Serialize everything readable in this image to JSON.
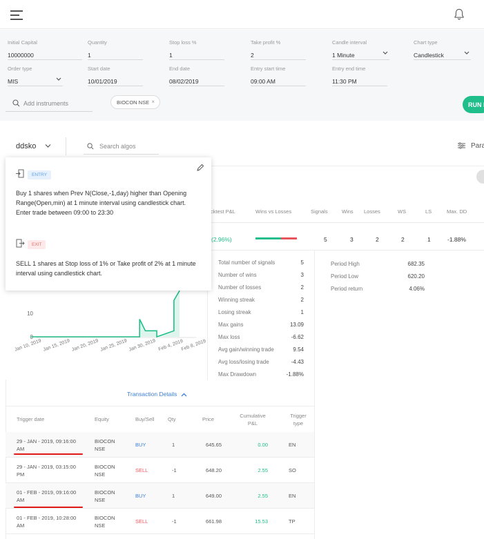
{
  "header": {
    "menu_icon": "hamburger-icon",
    "bell_icon": "bell-icon"
  },
  "form": {
    "initial_capital": {
      "label": "Initial Capital",
      "value": "10000000"
    },
    "quantity": {
      "label": "Quantity",
      "value": "1"
    },
    "stop_loss": {
      "label": "Stop loss %",
      "value": "1"
    },
    "take_profit": {
      "label": "Take profit %",
      "value": "2"
    },
    "candle_interval": {
      "label": "Candle interval",
      "value": "1 Minute"
    },
    "chart_type": {
      "label": "Chart type",
      "value": "Candlestick"
    },
    "order_type": {
      "label": "Order type",
      "value": "MIS"
    },
    "start_date": {
      "label": "Start date",
      "value": "10/01/2019"
    },
    "end_date": {
      "label": "End date",
      "value": "08/02/2019"
    },
    "entry_start_time": {
      "label": "Entry start time",
      "value": "09:00 AM"
    },
    "entry_end_time": {
      "label": "Entry end time",
      "value": "11:30 PM"
    },
    "instruments_placeholder": "Add instruments",
    "instrument_chip": "BIOCON NSE",
    "chip_close": "×",
    "run_label": "RUN I"
  },
  "algo": {
    "name": "ddsko",
    "search_placeholder": "Search algos",
    "params_label": "Para"
  },
  "popup": {
    "entry_tag": "ENTRY",
    "entry_text_1": "Buy 1 shares when Prev N(Close,-1,day) higher than Opening Range(Open,min) at 1 minute interval using candlestick chart.",
    "entry_text_2": "Enter trade between 09:00 to 23:30",
    "exit_tag": "EXIT",
    "exit_text": "SELL 1 shares at Stop loss of 1% or Take profit of 2% at 1 minute interval using candlestick chart."
  },
  "stats_header": {
    "backtest_pnl": "cktest P&L",
    "wins_vs_losses": "Wins vs Losses",
    "signals": "Signals",
    "wins": "Wins",
    "losses": "Losses",
    "ws": "WS",
    "ls": "LS",
    "max_dd": "Max. DD"
  },
  "stats_values": {
    "backtest_pnl": "(2.96%)",
    "signals": "5",
    "wins": "3",
    "losses": "2",
    "ws": "2",
    "ls": "1",
    "max_dd": "-1.88%",
    "wins_count": 3,
    "losses_count": 2
  },
  "stats_list": [
    {
      "label": "Total number of signals",
      "value": "5"
    },
    {
      "label": "Number of wins",
      "value": "3"
    },
    {
      "label": "Number of losses",
      "value": "2"
    },
    {
      "label": "Winning streak",
      "value": "2"
    },
    {
      "label": "Losing streak",
      "value": "1"
    },
    {
      "label": "Max gains",
      "value": "13.09"
    },
    {
      "label": "Max loss",
      "value": "-6.62"
    },
    {
      "label": "Avg gain/winning trade",
      "value": "9.54"
    },
    {
      "label": "Avg loss/losing trade",
      "value": "-4.43"
    },
    {
      "label": "Max Drawdown",
      "value": "-1.88%"
    }
  ],
  "period": [
    {
      "label": "Period High",
      "value": "682.35"
    },
    {
      "label": "Period Low",
      "value": "620.20"
    },
    {
      "label": "Period return",
      "value": "4.06%"
    }
  ],
  "chart_data": {
    "type": "area",
    "x_ticks": [
      "Jan 10, 2019",
      "Jan 15, 2019",
      "Jan 20, 2019",
      "Jan 25, 2019",
      "Jan 30, 2019",
      "Feb 4, 2019",
      "Feb 8, 2019"
    ],
    "y_ticks": [
      "0",
      "10"
    ],
    "visible_y_range": [
      -0.5,
      22
    ],
    "series": [
      {
        "x": [
          "2019-01-10",
          "2019-01-29",
          "2019-01-29",
          "2019-01-30",
          "2019-02-01",
          "2019-02-01",
          "2019-02-04",
          "2019-02-04",
          "2019-02-05"
        ],
        "values": [
          0,
          0,
          7.5,
          2.55,
          2.55,
          0,
          2.55,
          15.53,
          22
        ]
      }
    ],
    "color": "#1fbe8a"
  },
  "transactions": {
    "toggle_label": "Transaction Details",
    "headers": {
      "trigger_date": "Trigger date",
      "equity": "Equity",
      "buy_sell": "Buy/Sell",
      "qty": "Qty",
      "price": "Price",
      "cum_pnl_1": "Cumulative",
      "cum_pnl_2": "P&L",
      "trigger_type_1": "Trigger",
      "trigger_type_2": "type"
    },
    "rows": [
      {
        "date_1": "29 - JAN - 2019, 09:16:00",
        "date_2": "AM",
        "equity_1": "BIOCON",
        "equity_2": "NSE",
        "side": "BUY",
        "qty": "1",
        "price": "645.65",
        "pnl": "0.00",
        "type": "EN"
      },
      {
        "date_1": "29 - JAN - 2019, 03:15:00",
        "date_2": "PM",
        "equity_1": "BIOCON",
        "equity_2": "NSE",
        "side": "SELL",
        "qty": "-1",
        "price": "648.20",
        "pnl": "2.55",
        "type": "SO"
      },
      {
        "date_1": "01 - FEB - 2019, 09:16:00",
        "date_2": "AM",
        "equity_1": "BIOCON",
        "equity_2": "NSE",
        "side": "BUY",
        "qty": "1",
        "price": "649.00",
        "pnl": "2.55",
        "type": "EN"
      },
      {
        "date_1": "01 - FEB - 2019, 10:28:00",
        "date_2": "AM",
        "equity_1": "BIOCON",
        "equity_2": "NSE",
        "side": "SELL",
        "qty": "-1",
        "price": "661.98",
        "pnl": "15.53",
        "type": "TP"
      }
    ]
  }
}
